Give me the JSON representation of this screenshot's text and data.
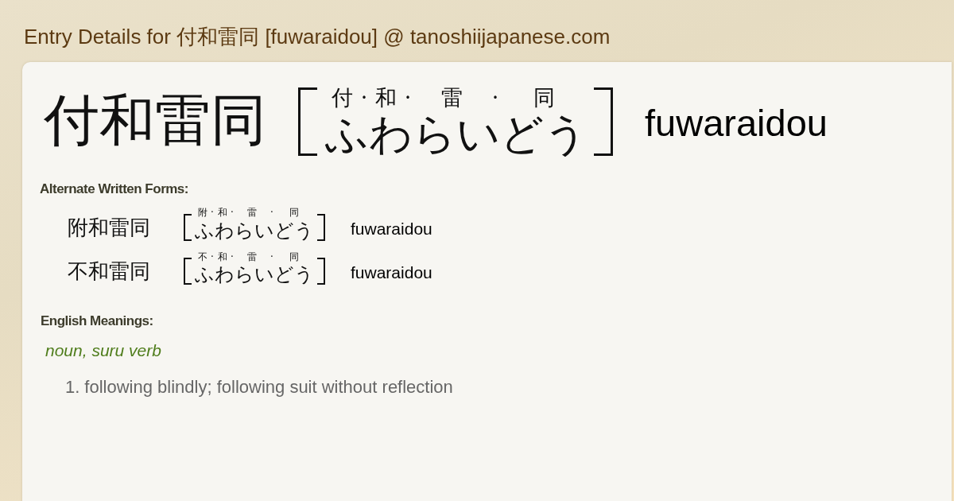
{
  "page_title": "Entry Details for 付和雷同 [fuwaraidou] @ tanoshiijapanese.com",
  "entry": {
    "word": "付和雷同",
    "reading": {
      "separator": "·",
      "segments": [
        {
          "kanji": "付",
          "kana": "ふ"
        },
        {
          "kanji": "和",
          "kana": "わ"
        },
        {
          "kanji": "雷",
          "kana": "らい"
        },
        {
          "kanji": "同",
          "kana": "どう"
        }
      ]
    },
    "romaji": "fuwaraidou"
  },
  "alternate_forms": {
    "heading": "Alternate Written Forms:",
    "items": [
      {
        "word": "附和雷同",
        "reading": {
          "separator": "·",
          "segments": [
            {
              "kanji": "附",
              "kana": "ふ"
            },
            {
              "kanji": "和",
              "kana": "わ"
            },
            {
              "kanji": "雷",
              "kana": "らい"
            },
            {
              "kanji": "同",
              "kana": "どう"
            }
          ]
        },
        "romaji": "fuwaraidou"
      },
      {
        "word": "不和雷同",
        "reading": {
          "separator": "·",
          "segments": [
            {
              "kanji": "不",
              "kana": "ふ"
            },
            {
              "kanji": "和",
              "kana": "わ"
            },
            {
              "kanji": "雷",
              "kana": "らい"
            },
            {
              "kanji": "同",
              "kana": "どう"
            }
          ]
        },
        "romaji": "fuwaraidou"
      }
    ]
  },
  "meanings": {
    "heading": "English Meanings:",
    "part_of_speech": "noun, suru verb",
    "senses": [
      {
        "number": "1.",
        "text": "following blindly; following suit without reflection"
      }
    ]
  }
}
